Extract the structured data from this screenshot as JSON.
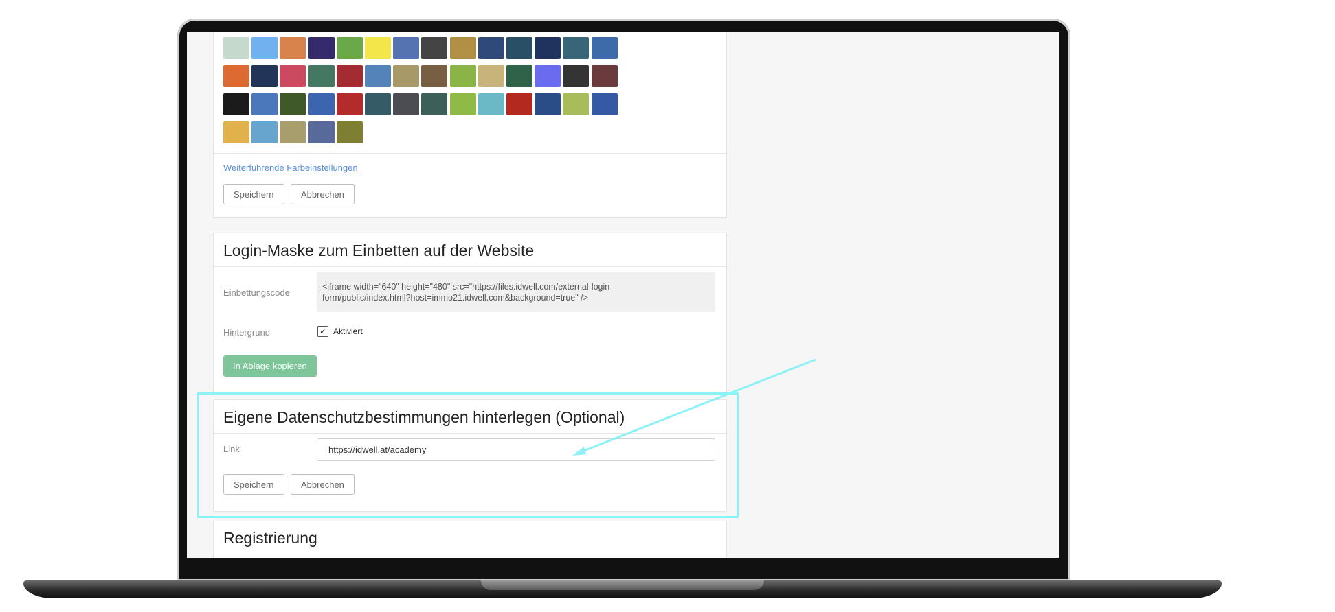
{
  "colors": {
    "swatches": [
      "#c5d9cd",
      "#71b1ef",
      "#d9834c",
      "#352b6c",
      "#6aa84a",
      "#f2e64a",
      "#5573b1",
      "#444444",
      "#b18f44",
      "#2f4a7a",
      "#294f67",
      "#20325e",
      "#386678",
      "#3d6aa9",
      "#dd6a30",
      "#223559",
      "#cb4a5f",
      "#457862",
      "#a32c32",
      "#5383b8",
      "#a89a68",
      "#785f44",
      "#8bb447",
      "#c8b47b",
      "#2f6249",
      "#6a6bef",
      "#343434",
      "#6b3a3d",
      "#1b1b1b",
      "#4a78bb",
      "#3f5a28",
      "#3b65ae",
      "#b32b2a",
      "#355b66",
      "#4b4d53",
      "#3c5f5a",
      "#8eba45",
      "#6bb9c6",
      "#b3291f",
      "#2b4d87",
      "#a9bc5c",
      "#3559a4",
      "#e1b24c",
      "#67a5cf",
      "#a89d6d",
      "#586a99",
      "#7e7f32"
    ],
    "link_text": "Weiterführende Farbeinstellungen",
    "save_label": "Speichern",
    "cancel_label": "Abbrechen"
  },
  "login_mask": {
    "title": "Login-Maske zum Einbetten auf der Website",
    "embed_label": "Einbettungscode",
    "embed_line1": "<iframe width=\"640\" height=\"480\" src=\"https://files.idwell.com/external-login-",
    "embed_line2": "form/public/index.html?host=immo21.idwell.com&background=true\" />",
    "background_label": "Hintergrund",
    "checkbox_label": "Aktiviert",
    "copy_button": "In Ablage kopieren"
  },
  "privacy": {
    "title": "Eigene Datenschutzbestimmungen hinterlegen (Optional)",
    "link_label": "Link",
    "link_value": "https://idwell.at/academy",
    "save_label": "Speichern",
    "cancel_label": "Abbrechen"
  },
  "registration": {
    "title": "Registrierung"
  },
  "accent": {
    "highlight": "#8df2f7",
    "button_green": "#7fc59a",
    "link_blue": "#5a8fd8"
  }
}
